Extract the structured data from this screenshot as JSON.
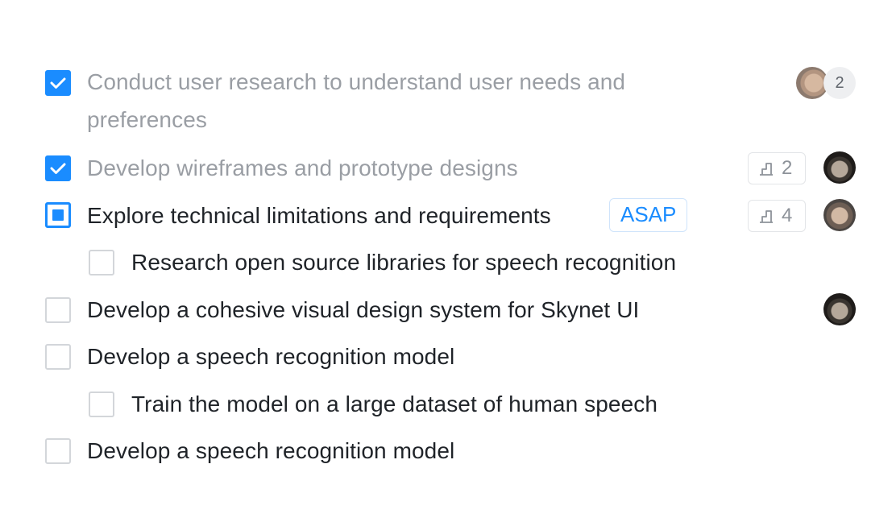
{
  "tasks": [
    {
      "label": "Conduct user research to understand user needs and",
      "label_line2": "preferences",
      "state": "checked",
      "assignee_extra": "2"
    },
    {
      "label": "Develop wireframes and prototype designs",
      "state": "checked",
      "subtasks": "2"
    },
    {
      "label": "Explore technical limitations and requirements",
      "state": "partial",
      "tag": "ASAP",
      "subtasks": "4"
    },
    {
      "label": "Research open source libraries for speech recognition",
      "state": "unchecked",
      "indent": 1
    },
    {
      "label": "Develop a cohesive visual design system for Skynet UI",
      "state": "unchecked"
    },
    {
      "label": "Develop a speech recognition model",
      "state": "unchecked"
    },
    {
      "label": "Train the model on a large dataset of human speech",
      "state": "unchecked",
      "indent": 1
    },
    {
      "label": "Develop a speech recognition model",
      "state": "unchecked"
    }
  ],
  "icons": {
    "check": "check-icon",
    "subtask": "subtask-icon",
    "avatar": "avatar"
  },
  "colors": {
    "accent": "#1a8cff",
    "done_text": "#9a9ea4",
    "text": "#1f2328",
    "border": "#d3d6da"
  }
}
